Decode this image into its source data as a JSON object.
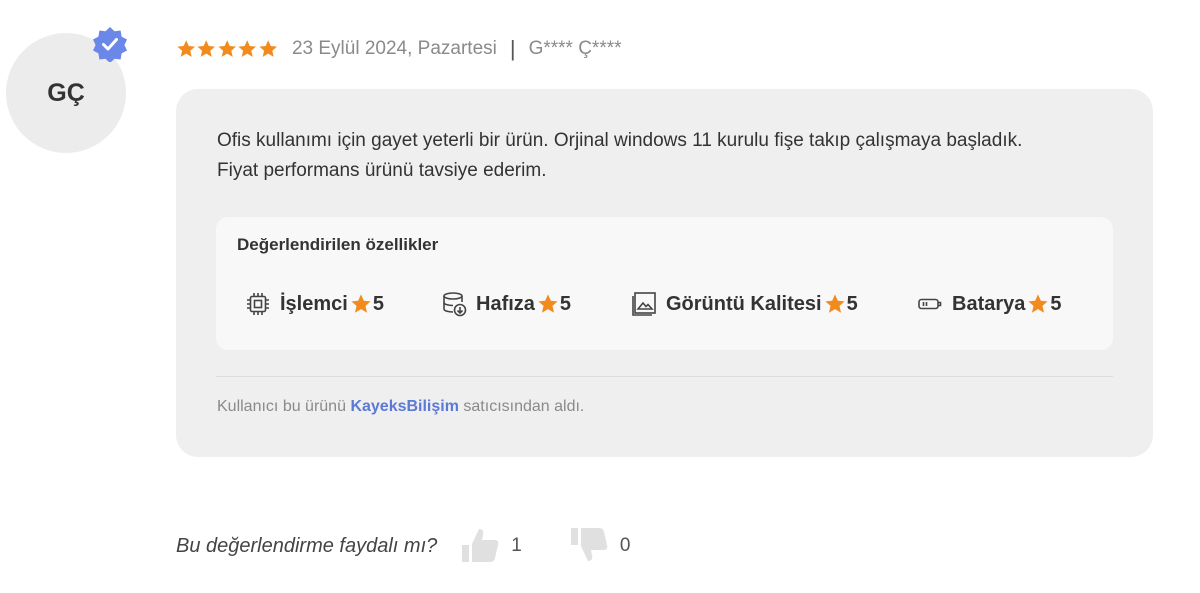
{
  "reviewer": {
    "initials": "GÇ",
    "verified_icon": "verified-check-icon"
  },
  "review": {
    "rating": 5,
    "date": "23 Eylül 2024, Pazartesi",
    "separator": "|",
    "author": "G**** Ç****",
    "text_line1": "Ofis kullanımı için gayet yeterli bir ürün. Orjinal windows 11 kurulu fişe takıp çalışmaya başladık.",
    "text_line2": "Fiyat performans ürünü tavsiye ederim."
  },
  "features": {
    "title": "Değerlendirilen özellikler",
    "items": [
      {
        "label": "İşlemci",
        "score": "5",
        "icon": "cpu-icon"
      },
      {
        "label": "Hafıza",
        "score": "5",
        "icon": "memory-icon"
      },
      {
        "label": "Görüntü Kalitesi",
        "score": "5",
        "icon": "image-icon"
      },
      {
        "label": "Batarya",
        "score": "5",
        "icon": "battery-icon"
      }
    ]
  },
  "seller": {
    "prefix": "Kullanıcı bu ürünü",
    "name": "KayeksBilişim",
    "suffix": "satıcısından aldı."
  },
  "helpful": {
    "question": "Bu değerlendirme faydalı mı?",
    "likes": "1",
    "dislikes": "0"
  },
  "colors": {
    "star": "#f28b1e",
    "link": "#5b7ad6",
    "badge": "#6b87e8",
    "card_bg": "#efefef"
  }
}
